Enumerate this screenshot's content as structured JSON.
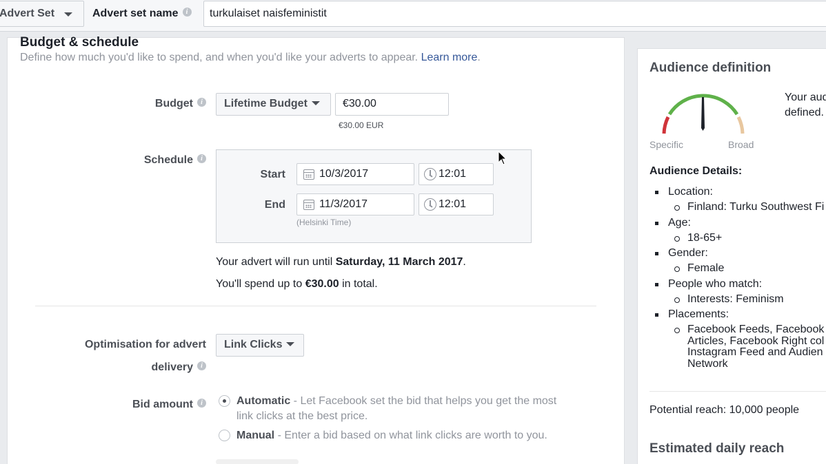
{
  "header": {
    "level_selector": "Advert Set",
    "set_name_label": "Advert set name",
    "set_name_value": "turkulaiset naisfeministit"
  },
  "budget_schedule": {
    "title": "Budget & schedule",
    "description": "Define how much you'd like to spend, and when you'd like your adverts to appear.",
    "learn_more": "Learn more",
    "budget_label": "Budget",
    "budget_type": "Lifetime Budget",
    "budget_amount": "€30.00",
    "budget_currency_note": "€30.00 EUR",
    "schedule_label": "Schedule",
    "start_label": "Start",
    "start_date": "10/3/2017",
    "start_time": "12:01",
    "end_label": "End",
    "end_date": "11/3/2017",
    "end_time": "12:01",
    "timezone": "(Helsinki Time)",
    "run_until_prefix": "Your advert will run until ",
    "run_until_date": "Saturday, 11 March 2017",
    "run_until_suffix": ".",
    "spend_prefix": "You'll spend up to ",
    "spend_amount": "€30.00",
    "spend_suffix": " in total."
  },
  "optimisation": {
    "label_line1": "Optimisation for advert",
    "label_line2": "delivery",
    "value": "Link Clicks"
  },
  "bid": {
    "label": "Bid amount",
    "options": [
      {
        "name": "Automatic",
        "desc_line1": " - Let Facebook set the bid that helps you get the most",
        "desc_line2": "link clicks at the best price.",
        "selected": true
      },
      {
        "name": "Manual",
        "desc_line1": " - Enter a bid based on what link clicks are worth to you.",
        "selected": false
      }
    ]
  },
  "audience": {
    "title": "Audience definition",
    "summary_line1": "Your aud",
    "summary_line2": "defined.",
    "gauge_left": "Specific",
    "gauge_right": "Broad",
    "details_title": "Audience Details:",
    "details": [
      {
        "label": "Location:",
        "values": [
          "Finland: Turku Southwest Fi"
        ]
      },
      {
        "label": "Age:",
        "values": [
          "18-65+"
        ]
      },
      {
        "label": "Gender:",
        "values": [
          "Female"
        ]
      },
      {
        "label": "People who match:",
        "values": [
          "Interests: Feminism"
        ]
      },
      {
        "label": "Placements:",
        "values": [
          "Facebook Feeds, Facebook",
          "Articles, Facebook Right col",
          "Instagram Feed and Audien",
          "Network"
        ]
      }
    ],
    "potential_reach": "Potential reach: 10,000 people",
    "estimated_title": "Estimated daily reach"
  },
  "colors": {
    "gauge_green": "#5fb14a",
    "gauge_red": "#d0343a",
    "gauge_tan": "#e8c79f",
    "link": "#365899"
  }
}
